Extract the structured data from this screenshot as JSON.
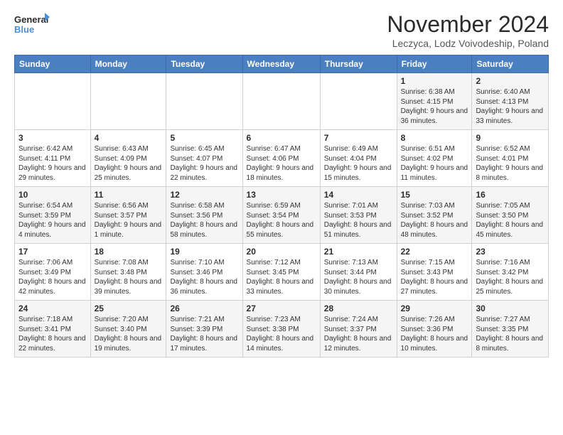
{
  "logo": {
    "line1": "General",
    "line2": "Blue"
  },
  "title": "November 2024",
  "location": "Leczyca, Lodz Voivodeship, Poland",
  "headers": [
    "Sunday",
    "Monday",
    "Tuesday",
    "Wednesday",
    "Thursday",
    "Friday",
    "Saturday"
  ],
  "weeks": [
    [
      {
        "day": "",
        "info": ""
      },
      {
        "day": "",
        "info": ""
      },
      {
        "day": "",
        "info": ""
      },
      {
        "day": "",
        "info": ""
      },
      {
        "day": "",
        "info": ""
      },
      {
        "day": "1",
        "info": "Sunrise: 6:38 AM\nSunset: 4:15 PM\nDaylight: 9 hours and 36 minutes."
      },
      {
        "day": "2",
        "info": "Sunrise: 6:40 AM\nSunset: 4:13 PM\nDaylight: 9 hours and 33 minutes."
      }
    ],
    [
      {
        "day": "3",
        "info": "Sunrise: 6:42 AM\nSunset: 4:11 PM\nDaylight: 9 hours and 29 minutes."
      },
      {
        "day": "4",
        "info": "Sunrise: 6:43 AM\nSunset: 4:09 PM\nDaylight: 9 hours and 25 minutes."
      },
      {
        "day": "5",
        "info": "Sunrise: 6:45 AM\nSunset: 4:07 PM\nDaylight: 9 hours and 22 minutes."
      },
      {
        "day": "6",
        "info": "Sunrise: 6:47 AM\nSunset: 4:06 PM\nDaylight: 9 hours and 18 minutes."
      },
      {
        "day": "7",
        "info": "Sunrise: 6:49 AM\nSunset: 4:04 PM\nDaylight: 9 hours and 15 minutes."
      },
      {
        "day": "8",
        "info": "Sunrise: 6:51 AM\nSunset: 4:02 PM\nDaylight: 9 hours and 11 minutes."
      },
      {
        "day": "9",
        "info": "Sunrise: 6:52 AM\nSunset: 4:01 PM\nDaylight: 9 hours and 8 minutes."
      }
    ],
    [
      {
        "day": "10",
        "info": "Sunrise: 6:54 AM\nSunset: 3:59 PM\nDaylight: 9 hours and 4 minutes."
      },
      {
        "day": "11",
        "info": "Sunrise: 6:56 AM\nSunset: 3:57 PM\nDaylight: 9 hours and 1 minute."
      },
      {
        "day": "12",
        "info": "Sunrise: 6:58 AM\nSunset: 3:56 PM\nDaylight: 8 hours and 58 minutes."
      },
      {
        "day": "13",
        "info": "Sunrise: 6:59 AM\nSunset: 3:54 PM\nDaylight: 8 hours and 55 minutes."
      },
      {
        "day": "14",
        "info": "Sunrise: 7:01 AM\nSunset: 3:53 PM\nDaylight: 8 hours and 51 minutes."
      },
      {
        "day": "15",
        "info": "Sunrise: 7:03 AM\nSunset: 3:52 PM\nDaylight: 8 hours and 48 minutes."
      },
      {
        "day": "16",
        "info": "Sunrise: 7:05 AM\nSunset: 3:50 PM\nDaylight: 8 hours and 45 minutes."
      }
    ],
    [
      {
        "day": "17",
        "info": "Sunrise: 7:06 AM\nSunset: 3:49 PM\nDaylight: 8 hours and 42 minutes."
      },
      {
        "day": "18",
        "info": "Sunrise: 7:08 AM\nSunset: 3:48 PM\nDaylight: 8 hours and 39 minutes."
      },
      {
        "day": "19",
        "info": "Sunrise: 7:10 AM\nSunset: 3:46 PM\nDaylight: 8 hours and 36 minutes."
      },
      {
        "day": "20",
        "info": "Sunrise: 7:12 AM\nSunset: 3:45 PM\nDaylight: 8 hours and 33 minutes."
      },
      {
        "day": "21",
        "info": "Sunrise: 7:13 AM\nSunset: 3:44 PM\nDaylight: 8 hours and 30 minutes."
      },
      {
        "day": "22",
        "info": "Sunrise: 7:15 AM\nSunset: 3:43 PM\nDaylight: 8 hours and 27 minutes."
      },
      {
        "day": "23",
        "info": "Sunrise: 7:16 AM\nSunset: 3:42 PM\nDaylight: 8 hours and 25 minutes."
      }
    ],
    [
      {
        "day": "24",
        "info": "Sunrise: 7:18 AM\nSunset: 3:41 PM\nDaylight: 8 hours and 22 minutes."
      },
      {
        "day": "25",
        "info": "Sunrise: 7:20 AM\nSunset: 3:40 PM\nDaylight: 8 hours and 19 minutes."
      },
      {
        "day": "26",
        "info": "Sunrise: 7:21 AM\nSunset: 3:39 PM\nDaylight: 8 hours and 17 minutes."
      },
      {
        "day": "27",
        "info": "Sunrise: 7:23 AM\nSunset: 3:38 PM\nDaylight: 8 hours and 14 minutes."
      },
      {
        "day": "28",
        "info": "Sunrise: 7:24 AM\nSunset: 3:37 PM\nDaylight: 8 hours and 12 minutes."
      },
      {
        "day": "29",
        "info": "Sunrise: 7:26 AM\nSunset: 3:36 PM\nDaylight: 8 hours and 10 minutes."
      },
      {
        "day": "30",
        "info": "Sunrise: 7:27 AM\nSunset: 3:35 PM\nDaylight: 8 hours and 8 minutes."
      }
    ]
  ]
}
